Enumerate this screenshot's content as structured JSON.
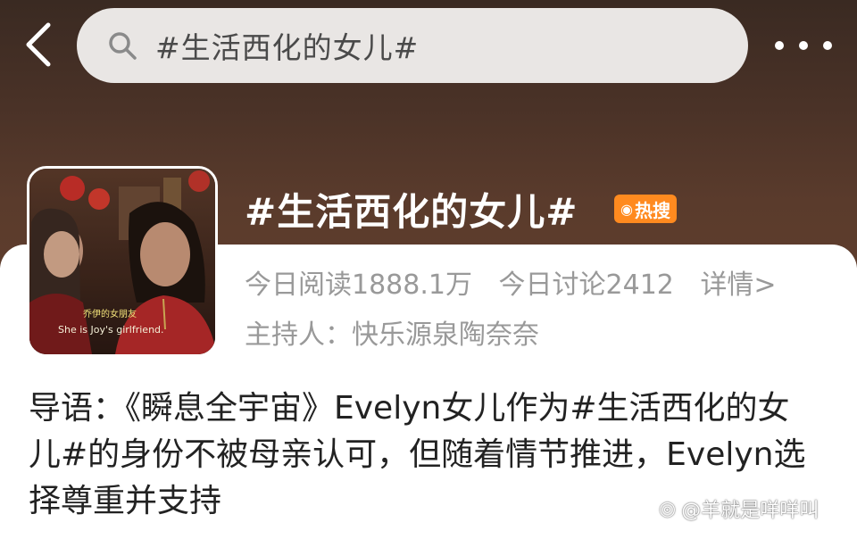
{
  "search": {
    "query": "#生活西化的女儿#"
  },
  "topic": {
    "title": "#生活西化的女儿#",
    "hot_badge": "热搜",
    "reads": "今日阅读1888.1万",
    "discussions": "今日讨论2412",
    "details": "详情>",
    "host": "主持人：快乐源泉陶奈奈",
    "thumbnail": {
      "subtitle_cn": "乔伊的女朋友",
      "subtitle_en": "She is Joy's girlfriend."
    }
  },
  "intro": {
    "text": "导语：《瞬息全宇宙》Evelyn女儿作为#生活西化的女儿#的身份不被母亲认可，但随着情节推进，Evelyn选择尊重并支持"
  },
  "watermark": {
    "text": "@羊就是咩咩叫"
  },
  "colors": {
    "header": "#4a3227",
    "badge": "#ff8a1f",
    "muted_text": "#999999"
  }
}
